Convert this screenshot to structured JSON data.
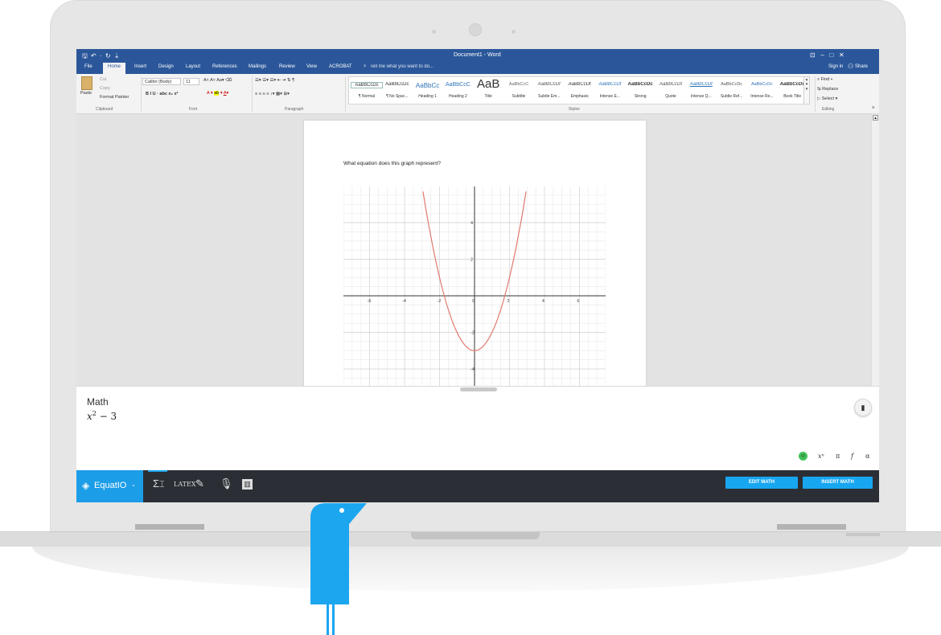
{
  "word": {
    "title": "Document1 - Word",
    "qat_glyphs": "🖫 ↶ · ↻ ⇣",
    "window_glyphs": "⊡   –   □   ✕",
    "tabs": [
      "File",
      "Home",
      "Insert",
      "Design",
      "Layout",
      "References",
      "Mailings",
      "Review",
      "View",
      "ACROBAT"
    ],
    "tell_me": "Tell me what you want to do...",
    "sign_in": "Sign in",
    "share": "Share",
    "clipboard": {
      "cut": "Cut",
      "copy": "Copy",
      "paste": "Paste",
      "format_painter": "Format Painter",
      "group": "Clipboard"
    },
    "font": {
      "name": "Calibri (Body)",
      "size": "11",
      "format_row": "B  I  U  ·  abc  x₂  x²",
      "group": "Font"
    },
    "paragraph": {
      "group": "Paragraph"
    },
    "styles": {
      "group": "Styles",
      "items": [
        {
          "preview": "AaBbCcDc",
          "name": "¶ Normal"
        },
        {
          "preview": "AaBbCcDc",
          "name": "¶ No Spac..."
        },
        {
          "preview": "AaBbCc",
          "name": "Heading 1"
        },
        {
          "preview": "AaBbCcC",
          "name": "Heading 2"
        },
        {
          "preview": "AaB",
          "name": "Title"
        },
        {
          "preview": "AaBbCcC",
          "name": "Subtitle"
        },
        {
          "preview": "AaBbCcDt",
          "name": "Subtle Em..."
        },
        {
          "preview": "AaBbCcDt",
          "name": "Emphasis"
        },
        {
          "preview": "AaBbCcDt",
          "name": "Intense E..."
        },
        {
          "preview": "AaBbCcDc",
          "name": "Strong"
        },
        {
          "preview": "AaBbCcDt",
          "name": "Quote"
        },
        {
          "preview": "AaBbCcDt",
          "name": "Intense Q..."
        },
        {
          "preview": "AaBbCcDc",
          "name": "Subtle Ref..."
        },
        {
          "preview": "AaBbCcDc",
          "name": "Intense Re..."
        },
        {
          "preview": "AaBbCcDc",
          "name": "Book Title"
        }
      ]
    },
    "editing": {
      "find": "Find",
      "replace": "Replace",
      "select": "Select",
      "group": "Editing"
    },
    "document": {
      "question": "What equation does this graph represent?"
    }
  },
  "graph": {
    "function": "y = x^2 - 3",
    "x_ticks": [
      "-6",
      "-4",
      "-2",
      "0",
      "2",
      "4",
      "6"
    ],
    "y_ticks": [
      "4",
      "2",
      "-2",
      "-4"
    ],
    "x_range": [
      -7.5,
      7.5
    ],
    "y_range": [
      -5.8,
      5.8
    ],
    "curve_color": "#e07a70"
  },
  "equatio": {
    "panel_title": "Math",
    "expression_base": "x",
    "expression_exp": "2",
    "expression_rest": " − 3",
    "logo": "EquatIO",
    "latex_label": "LATEX",
    "symbols": {
      "power": "xⁿ",
      "pi": "π",
      "func": "f",
      "alpha": "α"
    },
    "edit_math": "EDIT MATH",
    "insert_math": "INSERT MATH",
    "accent": "#1ca6f0"
  }
}
